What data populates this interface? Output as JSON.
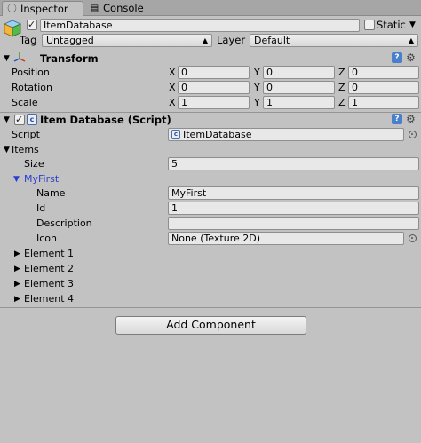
{
  "tabs": [
    {
      "label": "Inspector",
      "icon": "info-icon",
      "active": true
    },
    {
      "label": "Console",
      "icon": "console-icon",
      "active": false
    }
  ],
  "header": {
    "object_name": "ItemDatabase",
    "static_label": "Static",
    "tag_label": "Tag",
    "tag_value": "Untagged",
    "layer_label": "Layer",
    "layer_value": "Default"
  },
  "transform": {
    "title": "Transform",
    "rows": [
      {
        "label": "Position",
        "x": "0",
        "y": "0",
        "z": "0"
      },
      {
        "label": "Rotation",
        "x": "0",
        "y": "0",
        "z": "0"
      },
      {
        "label": "Scale",
        "x": "1",
        "y": "1",
        "z": "1"
      }
    ],
    "axis_x": "X",
    "axis_y": "Y",
    "axis_z": "Z"
  },
  "script_component": {
    "title": "Item Database (Script)",
    "script_label": "Script",
    "script_value": "ItemDatabase",
    "items_label": "Items",
    "size_label": "Size",
    "size_value": "5",
    "element0_label": "MyFirst",
    "fields": {
      "name_label": "Name",
      "name_value": "MyFirst",
      "id_label": "Id",
      "id_value": "1",
      "description_label": "Description",
      "description_value": "",
      "icon_label": "Icon",
      "icon_value": "None (Texture 2D)"
    },
    "elements": [
      "Element 1",
      "Element 2",
      "Element 3",
      "Element 4"
    ]
  },
  "add_component_label": "Add Component",
  "colors": {
    "background": "#c2c2c2",
    "field": "#e8e8e8",
    "selected_foldout": "#2a3fcf"
  }
}
